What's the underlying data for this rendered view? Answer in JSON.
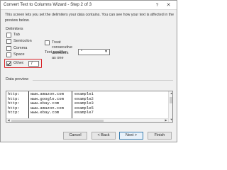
{
  "window": {
    "title": "Convert Text to Columns Wizard - Step 2 of 3",
    "help_glyph": "?",
    "close_glyph": "✕"
  },
  "intro_text": "This screen lets you set the delimiters your data contains. You can see how your text is affected in the preview below.",
  "delimiters": {
    "label": "Delimiters",
    "items": [
      {
        "label": "Tab",
        "checked": false
      },
      {
        "label": "Semicolon",
        "checked": false
      },
      {
        "label": "Comma",
        "checked": false
      },
      {
        "label": "Space",
        "checked": false
      },
      {
        "label": "Other:",
        "checked": true
      }
    ],
    "other_value": "/",
    "highlight_color": "#d9262b"
  },
  "treat_consecutive": {
    "label": "Treat consecutive delimiters as one",
    "checked": false
  },
  "text_qualifier": {
    "label": "Text qualifier:",
    "value": "\"",
    "arrow": "▼"
  },
  "preview": {
    "label": "Data preview",
    "rows": [
      [
        "http:",
        "www.amazon.com",
        "example1"
      ],
      [
        "http:",
        "www.google.com",
        "example2"
      ],
      [
        "http:",
        "www.ebay.com",
        "example3"
      ],
      [
        "http:",
        "www.amazon.com",
        "example5"
      ],
      [
        "http:",
        "www.ebay.com",
        "example7"
      ]
    ]
  },
  "scroll_glyphs": {
    "up": "▲",
    "down": "▼",
    "left": "◀",
    "right": "▶"
  },
  "buttons": {
    "cancel": "Cancel",
    "back": "< Back",
    "next": "Next >",
    "finish": "Finish"
  }
}
